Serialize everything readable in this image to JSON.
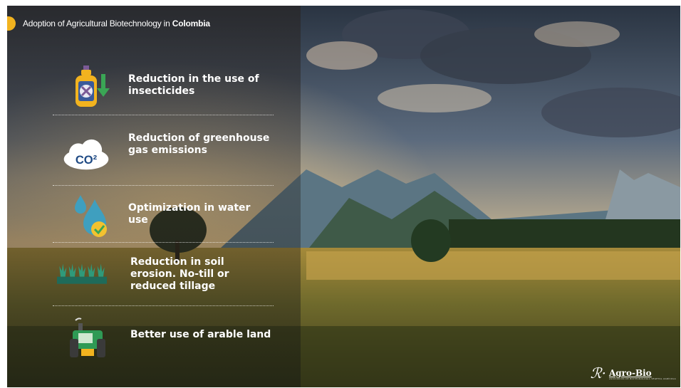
{
  "title": {
    "prefix": "Adoption of Agricultural Biotechnology in ",
    "country": "Colombia"
  },
  "items": [
    {
      "label": "Reduction in the use of insecticides",
      "icon": "insecticide-bottle-icon"
    },
    {
      "label": "Reduction of greenhouse gas emissions",
      "icon": "co2-cloud-icon",
      "icon_text": "CO²"
    },
    {
      "label": "Optimization in water use",
      "icon": "water-drops-icon"
    },
    {
      "label": "Reduction in soil erosion. No-till or reduced tillage",
      "icon": "crop-rows-icon"
    },
    {
      "label": "Better use of arable land",
      "icon": "tractor-icon"
    }
  ],
  "logo": {
    "name": "Agro-Bio",
    "tagline": "ASOCIACIÓN DE BIOTECNOLOGÍA VEGETAL AGRÍCOLA"
  },
  "colors": {
    "accent": "#f2b31f",
    "panel_text": "#ffffff",
    "arrow_green": "#3aa655",
    "cloud_blue": "#1f4a84",
    "drop_teal": "#3f9fbf",
    "crop_green": "#2f9a7a",
    "check_yellow": "#f2c230"
  }
}
